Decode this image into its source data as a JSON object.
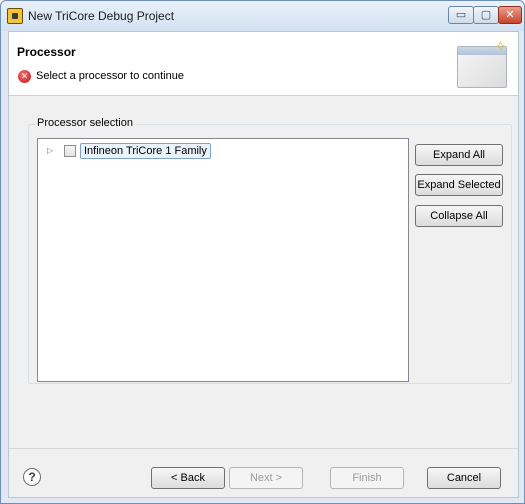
{
  "window": {
    "title": "New TriCore Debug Project",
    "controls": {
      "minimize": "▭",
      "maximize": "▢",
      "close": "✕"
    }
  },
  "header": {
    "title": "Processor",
    "message": "Select a processor to continue",
    "message_icon": "error-icon"
  },
  "processor_selection": {
    "group_label": "Processor selection",
    "tree": [
      {
        "label": "Infineon TriCore 1 Family",
        "expanded": false,
        "checked": false
      }
    ],
    "buttons": {
      "expand_all": "Expand All",
      "expand_selected": "Expand Selected",
      "collapse_all": "Collapse All"
    }
  },
  "footer": {
    "help_symbol": "?",
    "back": "< Back",
    "next": "Next >",
    "finish": "Finish",
    "cancel": "Cancel"
  }
}
